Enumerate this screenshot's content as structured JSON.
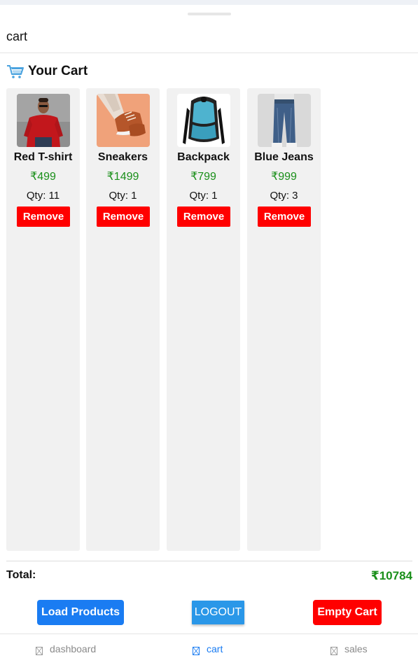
{
  "header": {
    "title": "cart"
  },
  "cart": {
    "heading": "Your Cart",
    "qty_prefix": "Qty: ",
    "remove_label": "Remove",
    "items": [
      {
        "name": "Red T-shirt",
        "price": "₹499",
        "qty": "11",
        "image": "red-tshirt-photo"
      },
      {
        "name": "Sneakers",
        "price": "₹1499",
        "qty": "1",
        "image": "sneakers-photo"
      },
      {
        "name": "Backpack",
        "price": "₹799",
        "qty": "1",
        "image": "backpack-photo"
      },
      {
        "name": "Blue Jeans",
        "price": "₹999",
        "qty": "3",
        "image": "blue-jeans-photo"
      }
    ]
  },
  "summary": {
    "total_label": "Total:",
    "total_value": "₹10784"
  },
  "actions": {
    "load_products": "Load Products",
    "logout": "LOGOUT",
    "empty_cart": "Empty Cart"
  },
  "tabs": [
    {
      "label": "dashboard",
      "active": false
    },
    {
      "label": "cart",
      "active": true
    },
    {
      "label": "sales",
      "active": false
    }
  ],
  "colors": {
    "price_green": "#1a8f1a",
    "remove_red": "#ff0000",
    "primary_blue": "#1a7cf2",
    "logout_blue": "#2a97e8",
    "card_bg": "#f1f1f1"
  }
}
